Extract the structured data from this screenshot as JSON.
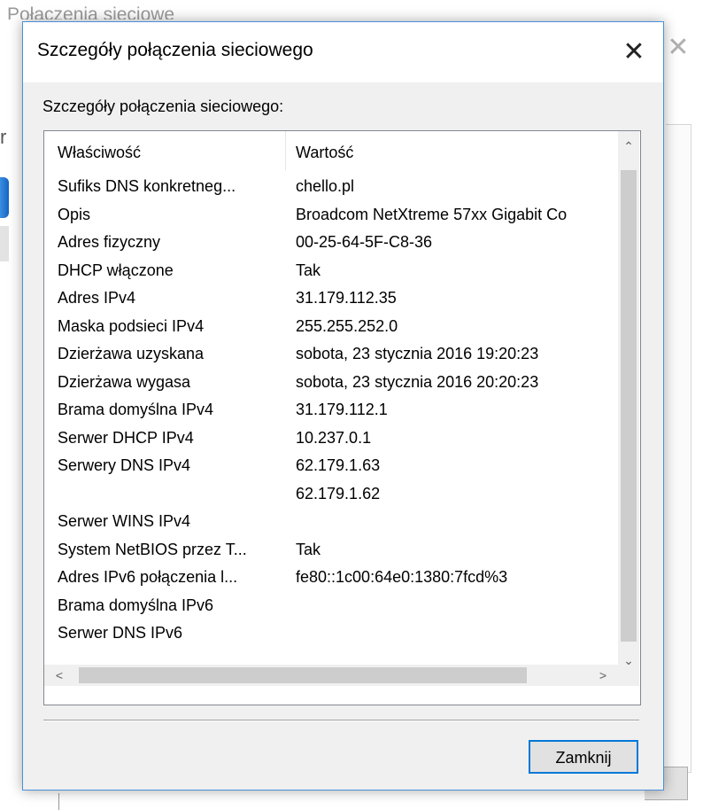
{
  "background": {
    "title": "Połączenia sieciowe",
    "left_letter": "rg"
  },
  "dialog": {
    "title": "Szczegóły połączenia sieciowego",
    "close_glyph": "✕",
    "group_label": "Szczegóły połączenia sieciowego:",
    "columns": {
      "property": "Właściwość",
      "value": "Wartość"
    },
    "rows": [
      {
        "property": "Sufiks DNS konkretneg...",
        "value": "chello.pl"
      },
      {
        "property": "Opis",
        "value": "Broadcom NetXtreme 57xx Gigabit Co"
      },
      {
        "property": "Adres fizyczny",
        "value": "00-25-64-5F-C8-36"
      },
      {
        "property": "DHCP włączone",
        "value": "Tak"
      },
      {
        "property": "Adres IPv4",
        "value": "31.179.112.35"
      },
      {
        "property": "Maska podsieci IPv4",
        "value": "255.255.252.0"
      },
      {
        "property": "Dzierżawa uzyskana",
        "value": "sobota, 23 stycznia 2016 19:20:23"
      },
      {
        "property": "Dzierżawa wygasa",
        "value": "sobota, 23 stycznia 2016 20:20:23"
      },
      {
        "property": "Brama domyślna IPv4",
        "value": "31.179.112.1"
      },
      {
        "property": "Serwer DHCP IPv4",
        "value": "10.237.0.1"
      },
      {
        "property": "Serwery DNS IPv4",
        "value": "62.179.1.63"
      },
      {
        "property": "",
        "value": "62.179.1.62"
      },
      {
        "property": "Serwer WINS IPv4",
        "value": ""
      },
      {
        "property": "System NetBIOS przez T...",
        "value": "Tak"
      },
      {
        "property": "Adres IPv6 połączenia l...",
        "value": "fe80::1c00:64e0:1380:7fcd%3"
      },
      {
        "property": "Brama domyślna IPv6",
        "value": ""
      },
      {
        "property": "Serwer DNS IPv6",
        "value": ""
      }
    ],
    "scroll": {
      "up": "⌃",
      "down": "⌄",
      "left": "<",
      "right": ">"
    },
    "close_button": "Zamknij"
  },
  "colors": {
    "accent_border": "#0078d7",
    "dialog_bg": "#f0f0f0",
    "scroll_thumb": "#cdcdcd"
  }
}
